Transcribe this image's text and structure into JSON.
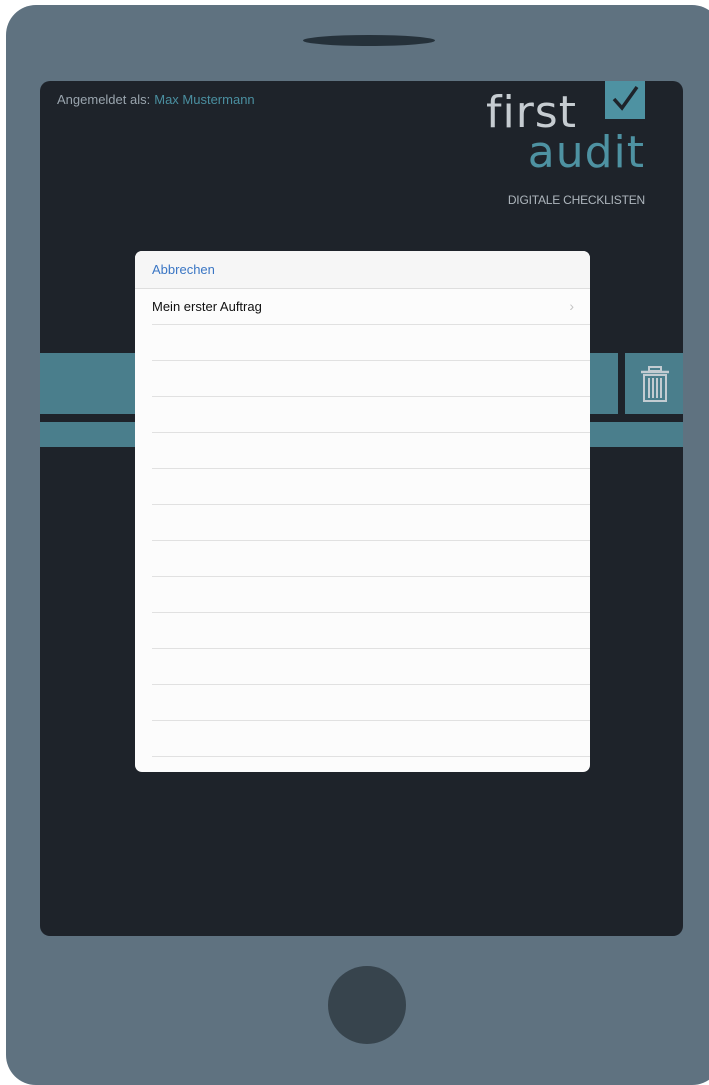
{
  "header": {
    "login_prefix": "Angemeldet als:",
    "user_name": "Max Mustermann"
  },
  "logo": {
    "word_top": "first",
    "word_bottom": "audit",
    "tagline": "DIGITALE CHECKLISTEN",
    "accent_color": "#4e92a2"
  },
  "modal": {
    "cancel_label": "Abbrechen",
    "items": [
      {
        "label": "Mein erster Auftrag"
      }
    ]
  },
  "icons": {
    "trash": "trash-icon",
    "check": "check-icon",
    "chevron": "chevron-right-icon"
  }
}
